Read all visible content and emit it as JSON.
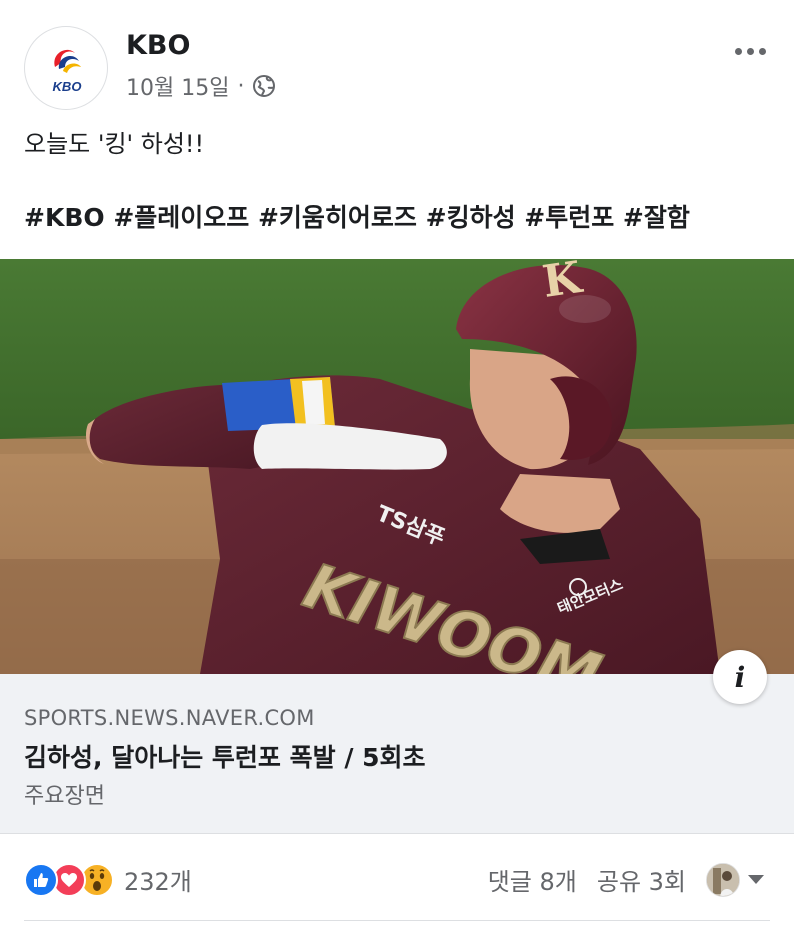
{
  "post": {
    "page_name": "KBO",
    "date": "10월 15일",
    "separator": "·",
    "logo_text": "KBO",
    "text": "오늘도 '킹' 하성!!",
    "hashtags": "#KBO #플레이오프 #키움히어로즈 #킹하성 #투런포 #잘함"
  },
  "media": {
    "helmet_letter": "K",
    "sponsor_chest": "TS삼푸",
    "team_text": "KIWOOM",
    "sponsor_sleeve": "태안모터스",
    "info_glyph": "i"
  },
  "link": {
    "domain": "SPORTS.NEWS.NAVER.COM",
    "title": "김하성, 달아나는 투런포 폭발 / 5회초",
    "description": "주요장면"
  },
  "footer": {
    "reaction_count": "232개",
    "comments": "댓글 8개",
    "shares": "공유 3회"
  },
  "icons": {
    "more": "more-horizontal-icon",
    "privacy": "globe-icon",
    "like": "like-reaction-icon",
    "love": "love-reaction-icon",
    "wow": "wow-reaction-icon"
  },
  "colors": {
    "fb_blue": "#1877f2",
    "love_red": "#f33e58",
    "wow_yellow": "#f7b125",
    "jersey_maroon": "#5a1f2c",
    "text_secondary": "#65676b"
  }
}
